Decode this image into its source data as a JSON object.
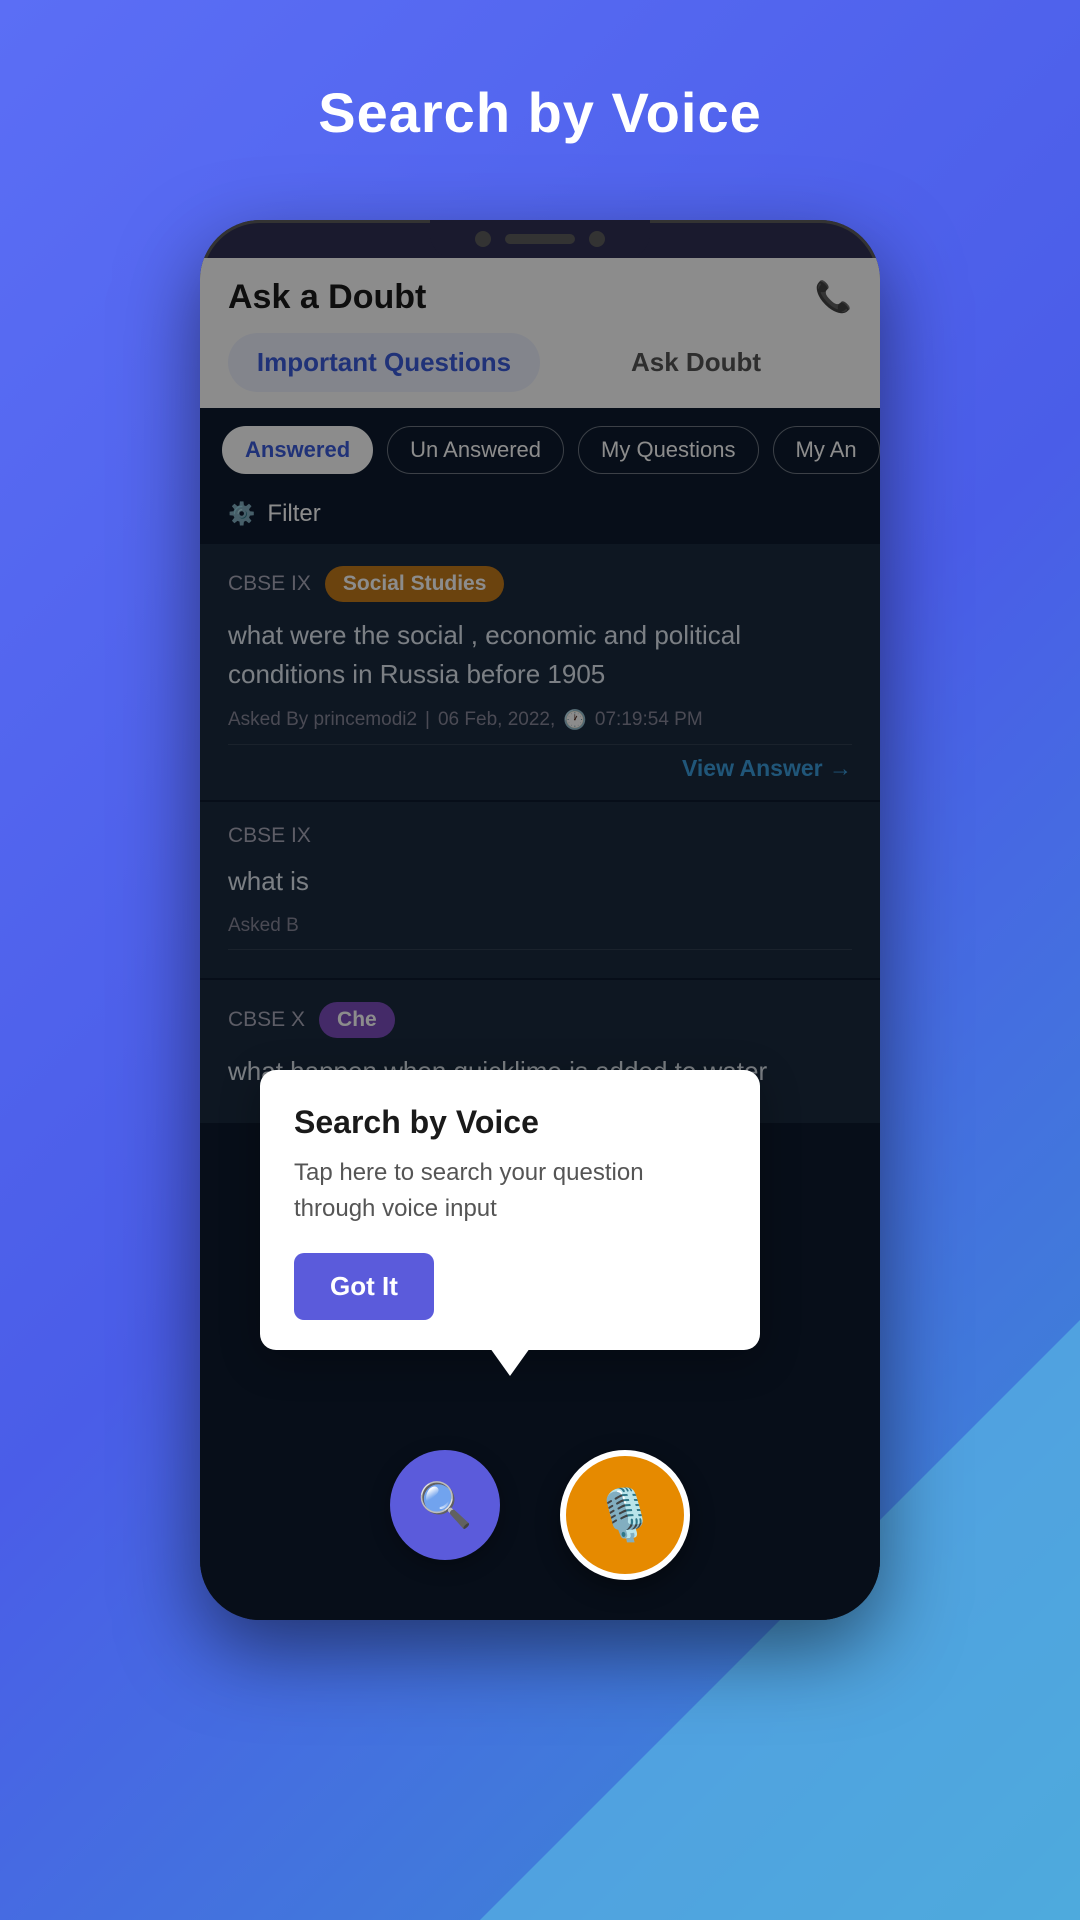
{
  "page": {
    "title": "Search by Voice",
    "bg_color": "#5b6ef5"
  },
  "app": {
    "header_title": "Ask a Doubt",
    "phone_icon": "📞",
    "tabs": [
      {
        "label": "Important Questions",
        "active": false
      },
      {
        "label": "Ask Doubt",
        "active": false
      }
    ],
    "chips": [
      {
        "label": "Answered",
        "active": true
      },
      {
        "label": "Un Answered",
        "active": false
      },
      {
        "label": "My Questions",
        "active": false
      },
      {
        "label": "My An",
        "active": false
      }
    ],
    "filter_label": "Filter"
  },
  "questions": [
    {
      "board": "CBSE IX",
      "subject": "Social Studies",
      "subject_color": "orange",
      "question": "what were the social , economic and political conditions in Russia before 1905",
      "asked_by": "princemodi2",
      "date": "06 Feb, 2022,",
      "time": "07:19:54 PM",
      "view_answer": "View Answer →"
    },
    {
      "board": "CBSE IX",
      "subject": "",
      "subject_color": "",
      "question": "what is",
      "asked_by": "Asked B",
      "date": "",
      "time": "",
      "view_answer": ""
    },
    {
      "board": "CBSE X",
      "subject": "Che",
      "subject_color": "purple",
      "question": "what happen when quicklime is added to water",
      "asked_by": "",
      "date": "",
      "time": "",
      "view_answer": ""
    }
  ],
  "tooltip": {
    "title": "Search by Voice",
    "description": "Tap here to search your question through voice input",
    "button_label": "Got It"
  },
  "buttons": {
    "search_icon": "🔍",
    "voice_icon": "🎙️"
  }
}
